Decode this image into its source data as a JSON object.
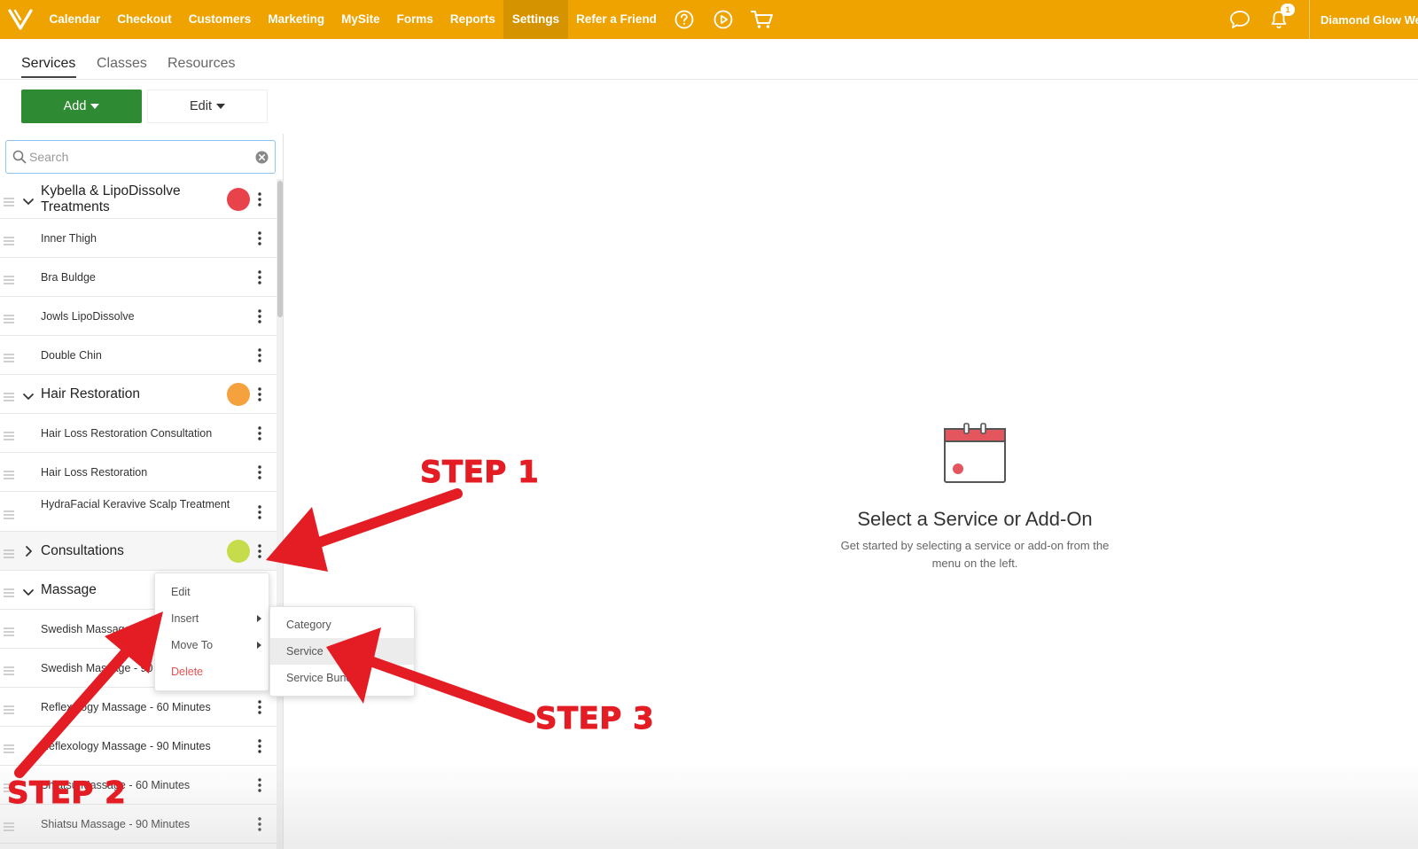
{
  "topbar": {
    "nav": [
      "Calendar",
      "Checkout",
      "Customers",
      "Marketing",
      "MySite",
      "Forms",
      "Reports",
      "Settings",
      "Refer a Friend"
    ],
    "active_index": 7,
    "notification_count": "1",
    "business_name": "Diamond Glow We"
  },
  "subtabs": [
    "Services",
    "Classes",
    "Resources"
  ],
  "toolbar": {
    "add_label": "Add",
    "edit_label": "Edit"
  },
  "search": {
    "placeholder": "Search"
  },
  "list": [
    {
      "type": "category",
      "label": "Kybella & LipoDissolve Treatments",
      "color": "#e8424b",
      "expanded": true
    },
    {
      "type": "service",
      "label": "Inner Thigh"
    },
    {
      "type": "service",
      "label": "Bra Buldge"
    },
    {
      "type": "service",
      "label": "Jowls LipoDissolve"
    },
    {
      "type": "service",
      "label": "Double Chin"
    },
    {
      "type": "category",
      "label": "Hair Restoration",
      "color": "#f5a13d",
      "expanded": true
    },
    {
      "type": "service",
      "label": "Hair Loss Restoration Consultation"
    },
    {
      "type": "service",
      "label": "Hair Loss Restoration"
    },
    {
      "type": "service",
      "label": "HydraFacial Keravive Scalp Treatment"
    },
    {
      "type": "category",
      "label": "Consultations",
      "color": "#c6dc4b",
      "expanded": false
    },
    {
      "type": "category",
      "label": "Massage",
      "expanded": true
    },
    {
      "type": "service",
      "label": "Swedish Massage - 60 Minutes"
    },
    {
      "type": "service",
      "label": "Swedish Massage - 90 Minutes"
    },
    {
      "type": "service",
      "label": "Reflexology Massage - 60 Minutes"
    },
    {
      "type": "service",
      "label": "Reflexology Massage - 90 Minutes"
    },
    {
      "type": "service",
      "label": "Shiatsu Massage - 60 Minutes"
    },
    {
      "type": "service",
      "label": "Shiatsu Massage - 90 Minutes"
    }
  ],
  "context_menu": {
    "items": [
      "Edit",
      "Insert",
      "Move To",
      "Delete"
    ]
  },
  "submenu": {
    "items": [
      "Category",
      "Service",
      "Service Bundle"
    ]
  },
  "empty_state": {
    "title": "Select a Service or Add-On",
    "subtitle": "Get started by selecting a service or add-on from the menu on the left."
  },
  "annotations": {
    "step1": "STEP 1",
    "step2": "STEP 2",
    "step3": "STEP 3"
  },
  "colors": {
    "topbar": "#efa300",
    "add_button": "#2e8b33",
    "arrow": "#e41d25"
  }
}
